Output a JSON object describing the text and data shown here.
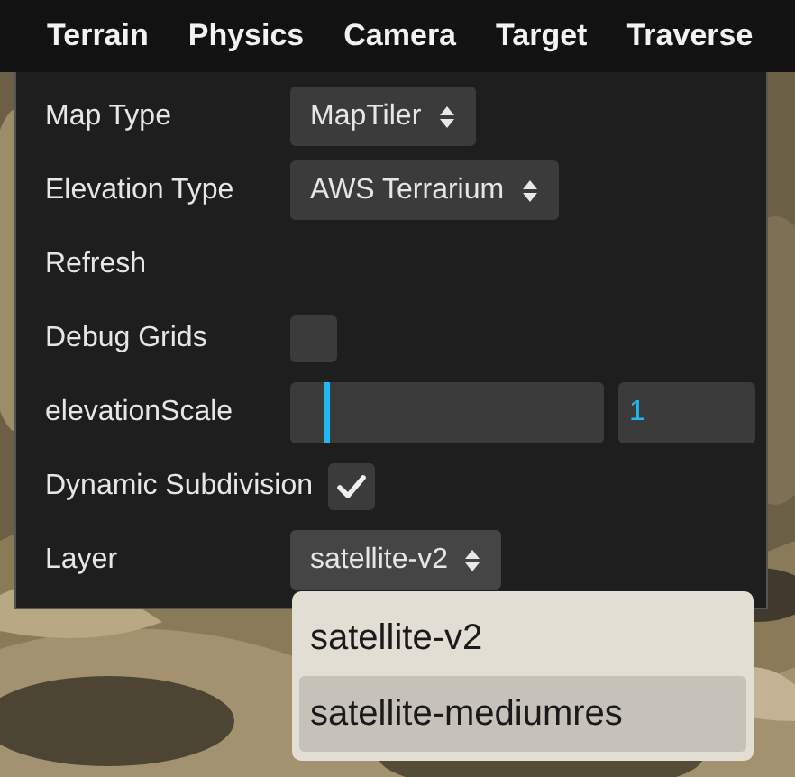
{
  "menu": [
    {
      "label": "Terrain"
    },
    {
      "label": "Physics"
    },
    {
      "label": "Camera"
    },
    {
      "label": "Target"
    },
    {
      "label": "Traverse"
    }
  ],
  "panel": {
    "rows": [
      {
        "kind": "select",
        "label": "Map Type",
        "value": "MapTiler"
      },
      {
        "kind": "select",
        "label": "Elevation Type",
        "value": "AWS Terrarium"
      },
      {
        "kind": "button",
        "label": "Refresh"
      },
      {
        "kind": "checkbox",
        "label": "Debug Grids",
        "checked": false
      },
      {
        "kind": "slider",
        "label": "elevationScale",
        "level": 0.11,
        "value": "1"
      },
      {
        "kind": "checkbox",
        "label": "Dynamic Subdivision",
        "checked": true
      },
      {
        "kind": "select",
        "label": "Layer",
        "value": "satellite-v2",
        "expanded": true
      }
    ]
  },
  "dropdown": {
    "options": [
      {
        "label": "satellite-v2",
        "selected": false
      },
      {
        "label": "satellite-mediumres",
        "selected": true
      }
    ]
  }
}
